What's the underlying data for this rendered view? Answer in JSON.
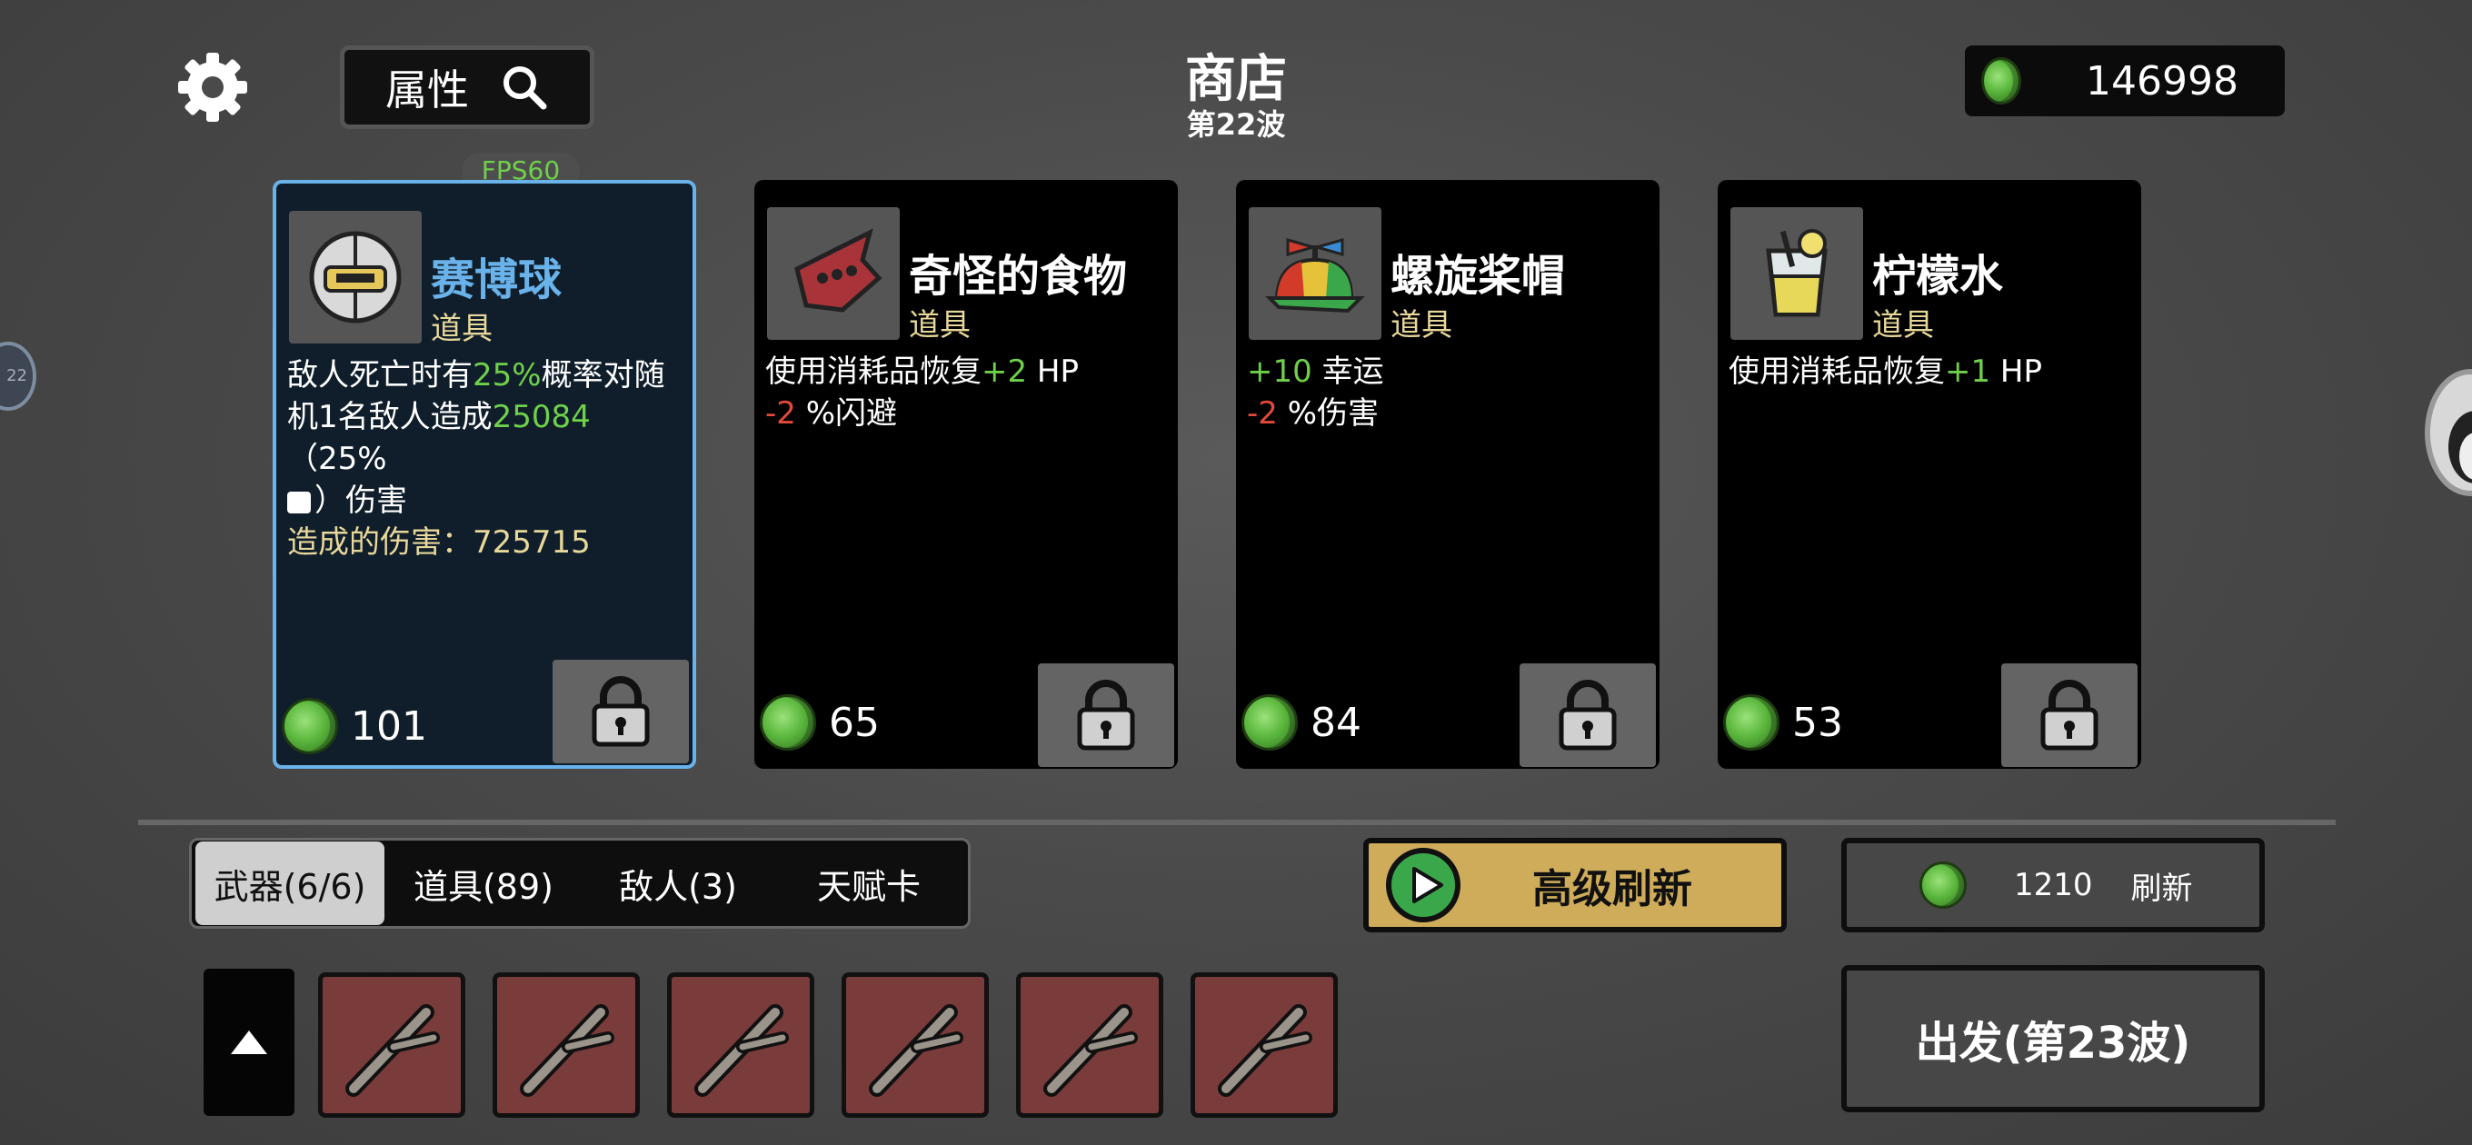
{
  "header": {
    "title": "商店",
    "wave": "第22波",
    "attr_label": "属性",
    "money": "146998",
    "fps": "FPS60"
  },
  "side_left_text": "22",
  "cards": [
    {
      "name": "赛博球",
      "kind": "道具",
      "price": "101",
      "desc": {
        "l1a": "敌人死亡时有",
        "l1b": "25%",
        "l1c": "概率对随",
        "l2a": "机1名敌人造成",
        "l2b": "25084",
        "l2c": "（25%",
        "l3": "）伤害",
        "l4a": "造成的伤害：",
        "l4b": "725715"
      }
    },
    {
      "name": "奇怪的食物",
      "kind": "道具",
      "price": "65",
      "desc": {
        "l1a": "使用消耗品恢复",
        "l1b": "+2",
        "l1c": " HP",
        "l2a": "-2",
        "l2b": " %闪避"
      }
    },
    {
      "name": "螺旋桨帽",
      "kind": "道具",
      "price": "84",
      "desc": {
        "l1a": "+10",
        "l1b": " 幸运",
        "l2a": "-2",
        "l2b": " %伤害"
      }
    },
    {
      "name": "柠檬水",
      "kind": "道具",
      "price": "53",
      "desc": {
        "l1a": "使用消耗品恢复",
        "l1b": "+1",
        "l1c": " HP"
      }
    }
  ],
  "tabs": [
    "武器(6/6)",
    "道具(89)",
    "敌人(3)",
    "天赋卡"
  ],
  "active_tab": 0,
  "adv_refresh_label": "高级刷新",
  "refresh": {
    "cost": "1210",
    "label": "刷新"
  },
  "depart_label": "出发(第23波)",
  "weapons": [
    "branch-icon",
    "branch-icon",
    "branch-icon",
    "branch-icon",
    "branch-icon",
    "branch-icon"
  ],
  "colors": {
    "accent_blue": "#6ab2ea",
    "positive": "#6fd04a",
    "negative": "#e24a3a",
    "category": "#e8d79a",
    "gold_button": "#cfac5a",
    "weapon_slot": "#7a3b3b"
  }
}
